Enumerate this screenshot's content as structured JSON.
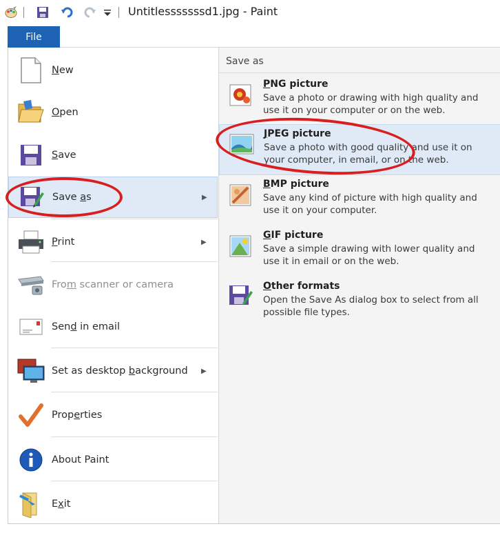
{
  "window": {
    "title": "Untitlesssssssd1.jpg - Paint"
  },
  "quick_access": {
    "icons": [
      "paint-app-icon",
      "save-icon",
      "undo-icon",
      "redo-icon",
      "customize-dropdown-icon"
    ]
  },
  "file_tab": {
    "label": "File"
  },
  "menu": {
    "items": [
      {
        "key": "new",
        "pre": "",
        "accel": "N",
        "post": "ew",
        "arrow": false,
        "disabled": false,
        "selected": false,
        "icon": "new-document-icon"
      },
      {
        "key": "open",
        "pre": "",
        "accel": "O",
        "post": "pen",
        "arrow": false,
        "disabled": false,
        "selected": false,
        "icon": "open-folder-icon"
      },
      {
        "key": "save",
        "pre": "",
        "accel": "S",
        "post": "ave",
        "arrow": false,
        "disabled": false,
        "selected": false,
        "icon": "save-disk-icon"
      },
      {
        "key": "save-as",
        "pre": "Save ",
        "accel": "a",
        "post": "s",
        "arrow": true,
        "disabled": false,
        "selected": true,
        "icon": "save-as-icon"
      },
      {
        "key": "print",
        "pre": "",
        "accel": "P",
        "post": "rint",
        "arrow": true,
        "disabled": false,
        "selected": false,
        "icon": "printer-icon"
      },
      {
        "key": "scanner",
        "pre": "Fro",
        "accel": "m",
        "post": " scanner or camera",
        "arrow": false,
        "disabled": true,
        "selected": false,
        "icon": "scanner-icon"
      },
      {
        "key": "email",
        "pre": "Sen",
        "accel": "d",
        "post": " in email",
        "arrow": false,
        "disabled": false,
        "selected": false,
        "icon": "email-icon"
      },
      {
        "key": "desktop-bg",
        "pre": "Set as desktop ",
        "accel": "b",
        "post": "ackground",
        "arrow": true,
        "disabled": false,
        "selected": false,
        "icon": "desktop-background-icon"
      },
      {
        "key": "properties",
        "pre": "Prop",
        "accel": "e",
        "post": "rties",
        "arrow": false,
        "disabled": false,
        "selected": false,
        "icon": "checkmark-icon"
      },
      {
        "key": "about",
        "pre": "About ",
        "accel": "",
        "post": "Paint",
        "arrow": false,
        "disabled": false,
        "selected": false,
        "icon": "info-icon"
      },
      {
        "key": "exit",
        "pre": "E",
        "accel": "x",
        "post": "it",
        "arrow": false,
        "disabled": false,
        "selected": false,
        "icon": "exit-icon"
      }
    ]
  },
  "save_as": {
    "header": "Save as",
    "options": [
      {
        "key": "png",
        "accel": "P",
        "rest": "NG picture",
        "desc": "Save a photo or drawing with high quality and use it on your computer or on the web.",
        "selected": false,
        "icon": "png-picture-icon"
      },
      {
        "key": "jpeg",
        "accel": "J",
        "rest": "PEG picture",
        "desc": "Save a photo with good quality and use it on your computer, in email, or on the web.",
        "selected": true,
        "icon": "jpeg-picture-icon"
      },
      {
        "key": "bmp",
        "accel": "B",
        "rest": "MP picture",
        "desc": "Save any kind of picture with high quality and use it on your computer.",
        "selected": false,
        "icon": "bmp-picture-icon"
      },
      {
        "key": "gif",
        "accel": "G",
        "rest": "IF picture",
        "desc": "Save a simple drawing with lower quality and use it in email or on the web.",
        "selected": false,
        "icon": "gif-picture-icon"
      },
      {
        "key": "other",
        "accel": "O",
        "rest": "ther formats",
        "desc": "Open the Save As dialog box to select from all possible file types.",
        "selected": false,
        "icon": "other-formats-icon"
      }
    ]
  },
  "colors": {
    "file_tab": "#1e62b4",
    "selection": "#dfeaf6",
    "annotation": "#d81e1e"
  }
}
